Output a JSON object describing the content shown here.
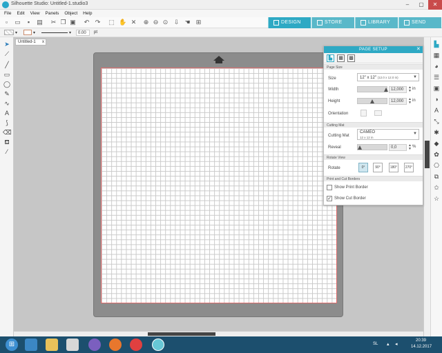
{
  "window": {
    "title": "Silhouette Studio: Untitled-1.studio3",
    "min": "–",
    "max": "▢",
    "close": "✕"
  },
  "menu": [
    "File",
    "Edit",
    "View",
    "Panels",
    "Object",
    "Help"
  ],
  "nav_tabs": [
    {
      "label": "DESIGN",
      "active": true
    },
    {
      "label": "STORE",
      "active": false
    },
    {
      "label": "LIBRARY",
      "active": false
    },
    {
      "label": "SEND",
      "active": false
    }
  ],
  "propbar": {
    "line_width": "0.00",
    "unit": "pt"
  },
  "document": {
    "tab_label": "Untitled-1",
    "tab_close": "x"
  },
  "page_setup": {
    "title": "PAGE SETUP",
    "close": "✕",
    "sections": {
      "page_size": "Page Size",
      "cutting_mat": "Cutting Mat",
      "rotate_view": "Rotate View",
      "borders": "Print and Cut Borders"
    },
    "size": {
      "label": "Size",
      "value": "12\" x 12\"",
      "detail": "(12.0 x 12.0 in)"
    },
    "width": {
      "label": "Width",
      "value": "12,000",
      "unit": "in"
    },
    "height": {
      "label": "Height",
      "value": "12,000",
      "unit": "in"
    },
    "orientation": {
      "label": "Orientation"
    },
    "mat": {
      "label": "Cutting Mat",
      "value": "CAMEO",
      "detail": "12 x 12 in"
    },
    "reveal": {
      "label": "Reveal",
      "value": "0,0",
      "unit": "%"
    },
    "rotate": {
      "label": "Rotate",
      "options": [
        "0°",
        "90°",
        "180°",
        "270°"
      ]
    },
    "show_print_border": {
      "label": "Show Print Border",
      "checked": false
    },
    "show_cut_border": {
      "label": "Show Cut Border",
      "checked": true
    }
  },
  "taskbar": {
    "lang": "SL",
    "time": "20:39",
    "date": "14.12.2017"
  },
  "colors": {
    "accent": "#2ea9c4",
    "cut_border": "#e06a6a",
    "taskbar": "#1c4f6e"
  }
}
